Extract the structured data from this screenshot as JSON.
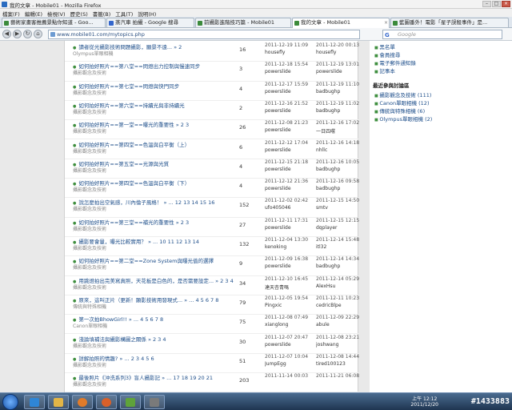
{
  "window": {
    "title": "我的文章 - Mobile01 - Mozilla Firefox"
  },
  "menu": [
    "檔案(F)",
    "編輯(E)",
    "檢視(V)",
    "歷史(S)",
    "書籤(B)",
    "工具(T)",
    "說明(H)"
  ],
  "tabs": [
    {
      "label": "藝術家畫客推薦景點你知道 - Goo..."
    },
    {
      "label": "蒸汽車 拍攝 - Google 搜尋"
    },
    {
      "label": "前攝影進階技巧篇 - Mobile01"
    },
    {
      "label": "我的文章 - Mobile01"
    },
    {
      "label": "藍圖番外！電影「星子誤殺事件」是..."
    }
  ],
  "nav": {
    "url": "www.mobile01.com/mytopics.php",
    "search_placeholder": "Google"
  },
  "topics": [
    {
      "title": "讀者從光攝影技術問題攝影，願景不遠... » 2",
      "forum": "Olympus單眼相機",
      "replies": "16",
      "post_date": "2011-12-19 11:09",
      "post_user": "housefly",
      "last_date": "2011-12-20 00:13",
      "last_user": "housefly"
    },
    {
      "title": "如何拍好照片==第八堂==閃燈出力控制與慢速同步",
      "forum": "攝影觀念及技術",
      "replies": "3",
      "post_date": "2011-12-18 15:54",
      "post_user": "powerslide",
      "last_date": "2011-12-19 13:01",
      "last_user": "powerslide"
    },
    {
      "title": "如何拍好照片==第七堂==閃燈與快門同步",
      "forum": "攝影觀念及技術",
      "replies": "4",
      "post_date": "2011-12-17 15:59",
      "post_user": "powerslide",
      "last_date": "2011-12-19 11:10",
      "last_user": "badbughp"
    },
    {
      "title": "如何拍好照片==第六堂==持續光與非持續光",
      "forum": "攝影觀念及技術",
      "replies": "2",
      "post_date": "2011-12-16 21:52",
      "post_user": "powerslide",
      "last_date": "2011-12-19 11:02",
      "last_user": "badbughp"
    },
    {
      "title": "如何拍好照片==第一堂==曝光的重要性 » 2 3",
      "forum": "攝影觀念及技術",
      "replies": "26",
      "post_date": "2011-12-08 21:23",
      "post_user": "powerslide",
      "last_date": "2011-12-16 17:02",
      "last_user": "一日四嚐"
    },
    {
      "title": "如何拍好照片==第四堂==色溫與白平衡（上）",
      "forum": "攝影觀念及技術",
      "replies": "6",
      "post_date": "2011-12-12 17:04",
      "post_user": "powerslide",
      "last_date": "2011-12-16 14:18",
      "last_user": "nhllc"
    },
    {
      "title": "如何拍好照片==第五堂==光源與光質",
      "forum": "攝影觀念及技術",
      "replies": "4",
      "post_date": "2011-12-15 21:18",
      "post_user": "powerslide",
      "last_date": "2011-12-16 10:05",
      "last_user": "badbughp"
    },
    {
      "title": "如何拍好照片==第四堂==色溫與白平衡（下）",
      "forum": "攝影觀念及技術",
      "replies": "4",
      "post_date": "2011-12-12 21:36",
      "post_user": "powerslide",
      "last_date": "2011-12-16 09:58",
      "last_user": "badbughp"
    },
    {
      "title": "說怎麼拍出空氣感，川內倫子風格！ » ... 12 13 14 15 16",
      "forum": "攝影觀念及技術",
      "replies": "152",
      "post_date": "2011-12-02 02:42",
      "post_user": "ufo405046",
      "last_date": "2011-12-15 14:50",
      "last_user": "smtv"
    },
    {
      "title": "如何拍好照片==第三堂==補光的重要性 » 2 3",
      "forum": "攝影觀念及技術",
      "replies": "27",
      "post_date": "2011-12-11 17:31",
      "post_user": "powerslide",
      "last_date": "2011-12-15 12:15",
      "last_user": "dqplayer"
    },
    {
      "title": "攝影要會量，曝光比較實用？ » ... 10 11 12 13 14",
      "forum": "攝影觀念及技術",
      "replies": "132",
      "post_date": "2011-12-04 13:30",
      "post_user": "kenoking",
      "last_date": "2011-12-14 15:48",
      "last_user": "itl32"
    },
    {
      "title": "如何拍好照片==第二堂==Zone System與曝光值的選擇",
      "forum": "攝影觀念及技術",
      "replies": "9",
      "post_date": "2011-12-09 16:38",
      "post_user": "powerslide",
      "last_date": "2011-12-14 14:34",
      "last_user": "badbughp"
    },
    {
      "title": "用跳燈拍出完美寫真照，天花板是白色的，是否需要設定... » 2 3 4",
      "forum": "攝影觀念及技術",
      "replies": "34",
      "post_date": "2011-12-10 16:45",
      "post_user": "達天杏青嗎",
      "last_date": "2011-12-14 05:29",
      "last_user": "AlexHsu"
    },
    {
      "title": "原來，這叫正片（更新！顯影技術用發現式... » ... 4 5 6 7 8",
      "forum": "傳統與特殊相機",
      "replies": "79",
      "post_date": "2011-12-05 19:54",
      "post_user": "Pingxic",
      "last_date": "2011-12-11 10:23",
      "last_user": "cedricBlpe"
    },
    {
      "title": "第一次拍BhowGirl!! » ... 4 5 6 7 8",
      "forum": "Canon單眼相機",
      "replies": "75",
      "post_date": "2011-12-08 07:49",
      "post_user": "xianglong",
      "last_date": "2011-12-09 22:29",
      "last_user": "abule"
    },
    {
      "title": "淺論填補法與攝影構圖之關係 » 2 3 4",
      "forum": "攝影觀念及技術",
      "replies": "30",
      "post_date": "2011-12-07 20:47",
      "post_user": "powerslide",
      "last_date": "2011-12-08 23:21",
      "last_user": "joshwang"
    },
    {
      "title": "詳解拍照的情趣? » ... 2 3 4 5 6",
      "forum": "攝影觀念及技術",
      "replies": "51",
      "post_date": "2011-12-07 10:04",
      "post_user": "JumpEgg",
      "last_date": "2011-12-08 14:44",
      "last_user": "tired100123"
    },
    {
      "title": "最後照片《沖洗系列3》盲人攝影記 » ... 17 18 19 20 21",
      "forum": "攝影觀念及技術",
      "replies": "203",
      "post_date": "2011-11-14 00:03",
      "post_user": "",
      "last_date": "2011-11-21 06:08",
      "last_user": ""
    }
  ],
  "sidebar": {
    "links": [
      "黑名單",
      "會員搜尋",
      "電子郵件通知錄",
      "記事本"
    ],
    "recent_heading": "最近參與討論區",
    "recent": [
      "攝影觀念及技術 (111)",
      "Canon單眼相機 (12)",
      "傳統與特殊相機 (6)",
      "Olympus單眼相機 (2)"
    ]
  },
  "taskbar": {
    "time": "上午 12:12",
    "date": "2011/12/20",
    "watermark": "#1433883"
  },
  "colors": {
    "accent": "#1d4e8a",
    "bullet": "#3f8f3f",
    "taskbar": "#1f3550"
  }
}
